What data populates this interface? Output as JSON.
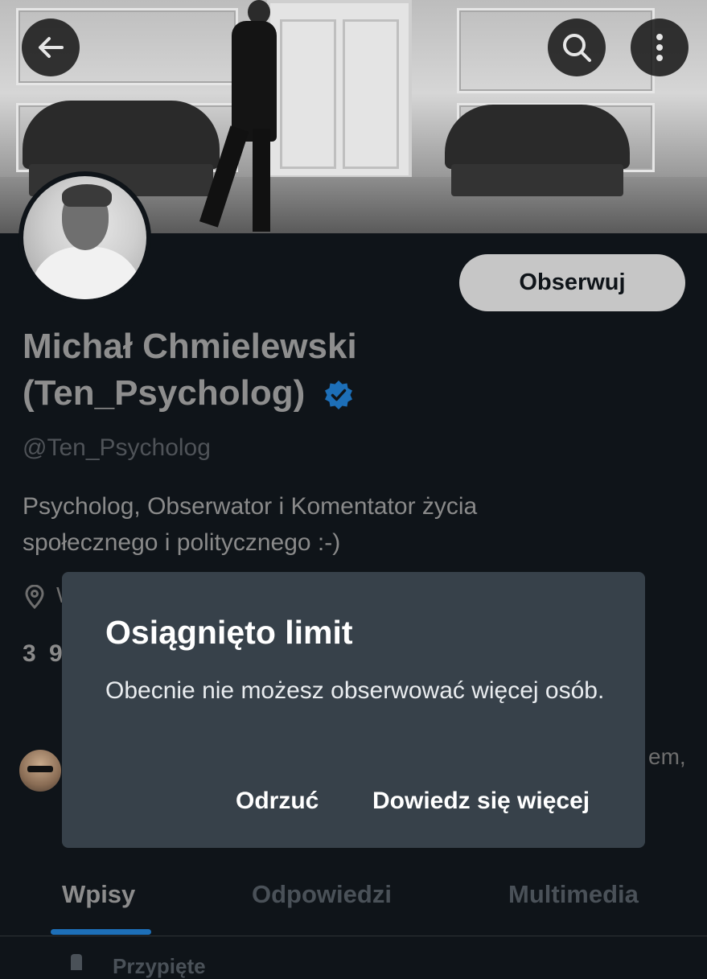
{
  "header": {
    "back_icon": "arrow-left-icon",
    "search_icon": "search-icon",
    "more_icon": "more-vertical-icon"
  },
  "profile": {
    "follow_label": "Obserwuj",
    "name_line1": "Michał Chmielewski",
    "name_line2": "(Ten_Psycholog)",
    "handle": "@Ten_Psycholog",
    "bio_line1": "Psycholog, Obserwator i Komentator życia",
    "bio_line2": "społecznego i politycznego :-)",
    "location_fragment": "W",
    "stats_fragment": "3 9",
    "followed_by_fragment": "em,",
    "verified_color": "#1d9bf0"
  },
  "dialog": {
    "title": "Osiągnięto limit",
    "message": "Obecnie nie możesz obserwować więcej osób.",
    "dismiss_label": "Odrzuć",
    "learn_more_label": "Dowiedz się więcej"
  },
  "tabs": [
    {
      "label": "Wpisy",
      "active": true
    },
    {
      "label": "Odpowiedzi",
      "active": false
    },
    {
      "label": "Multimedia",
      "active": false
    }
  ],
  "pinned_fragment": "Przypięte",
  "colors": {
    "background": "#0f1419",
    "dialog": "#37414a",
    "accent": "#1d6fb8"
  }
}
